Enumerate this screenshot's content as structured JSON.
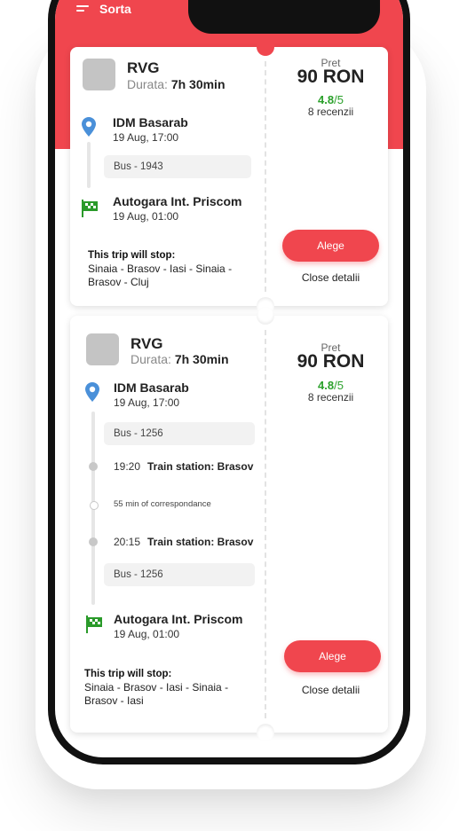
{
  "header": {
    "sort_label": "Sorta",
    "accent_color": "#f0464e"
  },
  "trips": [
    {
      "company": "RVG",
      "duration_label": "Durata:",
      "duration_value": "7h 30min",
      "departure": {
        "name": "IDM Basarab",
        "datetime": "19 Aug, 17:00"
      },
      "bus": "Bus - 1943",
      "arrival": {
        "name": "Autogara Int. Priscom",
        "datetime": "19 Aug, 01:00"
      },
      "stops_title": "This trip will stop:",
      "stops_line1": "Sinaia - Brasov - Iasi - Sinaia -",
      "stops_line2": "Brasov - Cluj",
      "price_label": "Pret",
      "price": "90 RON",
      "rating": "4.8",
      "rating_max": "/5",
      "reviews": "8 recenzii",
      "choose_label": "Alege",
      "details_label": "Close detalii"
    },
    {
      "company": "RVG",
      "duration_label": "Durata:",
      "duration_value": "7h 30min",
      "departure": {
        "name": "IDM Basarab",
        "datetime": "19 Aug, 17:00"
      },
      "bus_first": "Bus - 1256",
      "transfer": {
        "arrive_time": "19:20",
        "arrive_station": "Train station: Brasov",
        "wait": "55 min of correspondance",
        "depart_time": "20:15",
        "depart_station": "Train station: Brasov"
      },
      "bus_second": "Bus - 1256",
      "arrival": {
        "name": "Autogara Int. Priscom",
        "datetime": "19 Aug, 01:00"
      },
      "stops_title": "This trip will stop:",
      "stops_line1": "Sinaia - Brasov - Iasi - Sinaia -",
      "stops_line2": "Brasov - Iasi",
      "price_label": "Pret",
      "price": "90 RON",
      "rating": "4.8",
      "rating_max": "/5",
      "reviews": "8 recenzii",
      "choose_label": "Alege",
      "details_label": "Close detalii"
    }
  ],
  "icons": {
    "menu": "menu-icon",
    "departure": "location-pin-icon",
    "arrival": "checkered-flag-icon"
  }
}
